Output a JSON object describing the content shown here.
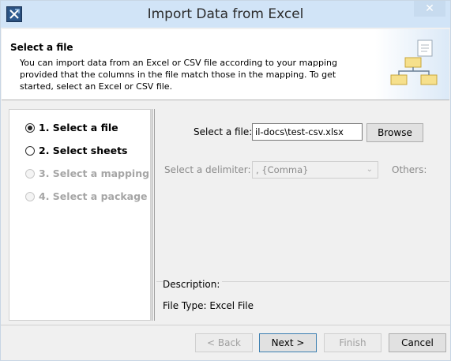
{
  "window": {
    "title": "Import Data from Excel",
    "close_glyph": "✕",
    "icon": "app-icon"
  },
  "header": {
    "title": "Select a file",
    "description": "You can import data from an Excel or CSV file according to your mapping provided that the columns in the file match those in the mapping. To get started, select an Excel or CSV file."
  },
  "steps": [
    {
      "label": "1. Select a file",
      "checked": true,
      "enabled": true
    },
    {
      "label": "2. Select sheets",
      "checked": false,
      "enabled": true
    },
    {
      "label": "3. Select a mapping",
      "checked": false,
      "enabled": false
    },
    {
      "label": "4. Select a package",
      "checked": false,
      "enabled": false
    }
  ],
  "form": {
    "file_label": "Select a file:",
    "file_value": "il-docs\\test-csv.xlsx",
    "browse_label": "Browse",
    "delimiter_label": "Select a delimiter:",
    "delimiter_value": ", {Comma}",
    "others_label": "Others:"
  },
  "description": {
    "label": "Description:",
    "file_type": "File Type: Excel File"
  },
  "buttons": {
    "back": "< Back",
    "next": "Next >",
    "finish": "Finish",
    "cancel": "Cancel"
  }
}
